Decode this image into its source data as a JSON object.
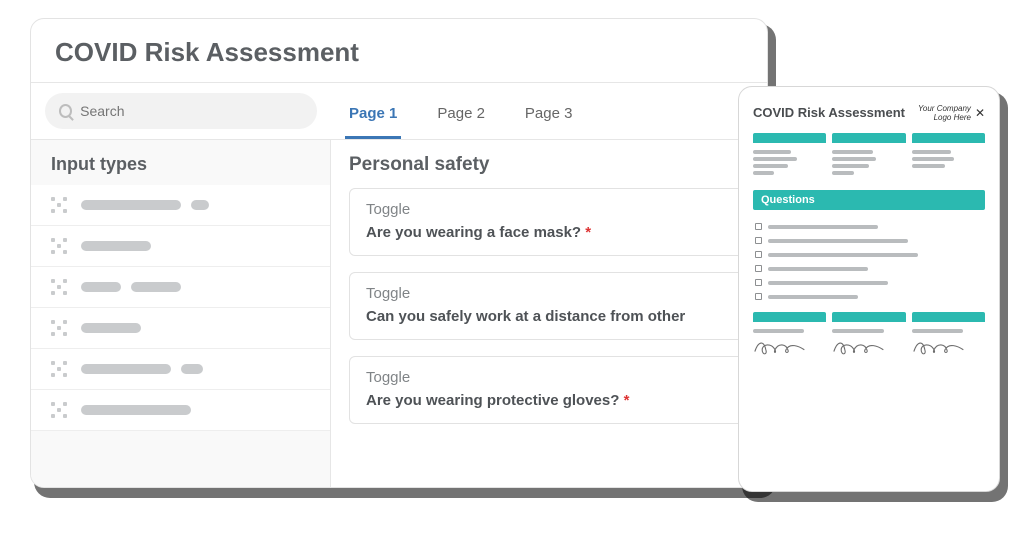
{
  "builder": {
    "title": "COVID Risk Assessment",
    "search_placeholder": "Search",
    "tabs": [
      "Page 1",
      "Page 2",
      "Page 3"
    ],
    "active_tab_index": 0,
    "sidebar_title": "Input types",
    "sidebar_items": [
      {
        "bars": [
          100,
          18
        ]
      },
      {
        "bars": [
          70
        ]
      },
      {
        "bars": [
          40,
          50
        ]
      },
      {
        "bars": [
          60
        ]
      },
      {
        "bars": [
          90,
          22
        ]
      },
      {
        "bars": [
          110
        ]
      }
    ],
    "section_title": "Personal safety",
    "questions": [
      {
        "type": "Toggle",
        "text": "Are you wearing a face mask?",
        "required": true
      },
      {
        "type": "Toggle",
        "text": "Can you safely work at a distance from other",
        "required": false
      },
      {
        "type": "Toggle",
        "text": "Are you wearing protective gloves?",
        "required": true
      }
    ]
  },
  "preview": {
    "title": "COVID Risk Assessment",
    "logo_line1": "Your Company",
    "logo_line2": "Logo Here",
    "top_boxes": [
      {
        "lines": [
          52,
          60,
          48,
          28
        ]
      },
      {
        "lines": [
          56,
          60,
          50,
          30
        ]
      },
      {
        "lines": [
          54,
          58,
          46
        ]
      }
    ],
    "questions_header": "Questions",
    "question_rows": [
      110,
      140,
      150,
      100,
      120,
      90
    ],
    "sig_boxes": [
      true,
      true,
      true
    ]
  }
}
